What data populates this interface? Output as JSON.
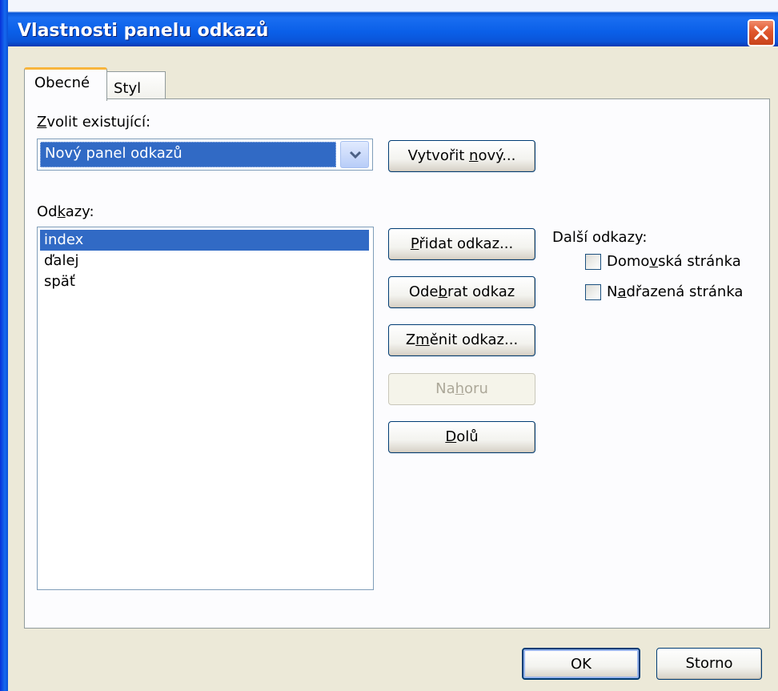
{
  "window": {
    "title": "Vlastnosti panelu odkazů"
  },
  "tabs": [
    {
      "label": "Obecné",
      "active": true
    },
    {
      "label": "Styl",
      "active": false
    }
  ],
  "choose_existing": {
    "label_mnemonic": "Z",
    "label_rest": "volit existující:",
    "selected_value": "Nový panel odkazů"
  },
  "create_new_button": {
    "before": "Vytvořit ",
    "mnemonic": "n",
    "after": "ový..."
  },
  "links": {
    "label_before": "Od",
    "label_mnemonic": "k",
    "label_after": "azy:",
    "items": [
      "index",
      "ďalej",
      "späť"
    ],
    "selected_index": 0
  },
  "buttons": {
    "add": {
      "before": "",
      "mnemonic": "P",
      "after": "řidat odkaz..."
    },
    "remove": {
      "before": "Ode",
      "mnemonic": "b",
      "after": "rat odkaz"
    },
    "change": {
      "before": "Z",
      "mnemonic": "m",
      "after": "ěnit odkaz..."
    },
    "up": {
      "before": "Na",
      "mnemonic": "h",
      "after": "oru",
      "disabled": true
    },
    "down": {
      "before": "",
      "mnemonic": "D",
      "after": "olů"
    },
    "ok": "OK",
    "cancel": "Storno"
  },
  "more_links": {
    "label": "Další odkazy:",
    "home": {
      "before": "Domo",
      "mnemonic": "v",
      "after": "ská stránka",
      "checked": false
    },
    "parent": {
      "before": "N",
      "mnemonic": "a",
      "after": "dřazená stránka",
      "checked": false
    }
  },
  "colors": {
    "selection": "#316ac5",
    "dialog_bg": "#ece9d8",
    "titlebar": "#0a5fe8",
    "close_button": "#e0562c"
  },
  "icons": {
    "close": "close-icon",
    "dropdown": "chevron-down-icon"
  }
}
